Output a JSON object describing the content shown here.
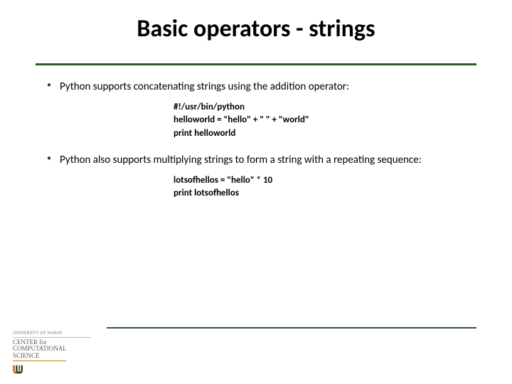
{
  "title": "Basic operators - strings",
  "bullets": [
    {
      "text": "Python supports concatenating strings using the addition operator:",
      "code": "#!/usr/bin/python\nhelloworld = \"hello\" + \" \" + \"world\"\nprint helloworld"
    },
    {
      "text": "Python also supports multiplying strings to form a string with a repeating sequence:",
      "code": "lotsofhellos = \"hello\" * 10\nprint lotsofhellos"
    }
  ],
  "footer": {
    "university_line": "UNIVERSITY OF MIAMI",
    "center_line1": "CENTER for",
    "center_line2": "COMPUTATIONAL",
    "center_line3": "SCIENCE"
  }
}
